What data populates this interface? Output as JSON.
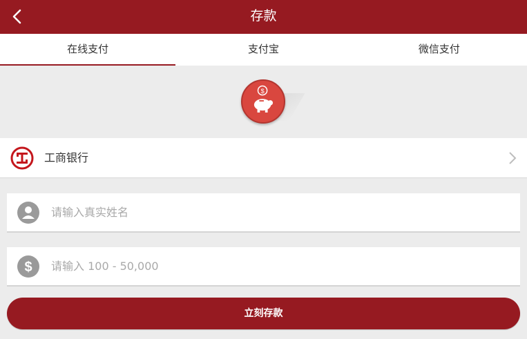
{
  "colors": {
    "primary": "#961a21",
    "background": "#ececec",
    "piggy_accent": "#d9473f"
  },
  "header": {
    "title": "存款",
    "back_icon": "chevron-left-icon"
  },
  "tabs": [
    {
      "label": "在线支付",
      "active": true
    },
    {
      "label": "支付宝",
      "active": false
    },
    {
      "label": "微信支付",
      "active": false
    }
  ],
  "hero": {
    "icon": "piggy-bank-icon"
  },
  "bank": {
    "name": "工商银行",
    "logo_icon": "icbc-logo-icon",
    "chevron_icon": "chevron-right-icon"
  },
  "form": {
    "name_placeholder": "请输入真实姓名",
    "name_icon": "user-icon",
    "amount_placeholder": "请输入 100 - 50,000",
    "amount_icon": "dollar-icon"
  },
  "submit_label": "立刻存款"
}
